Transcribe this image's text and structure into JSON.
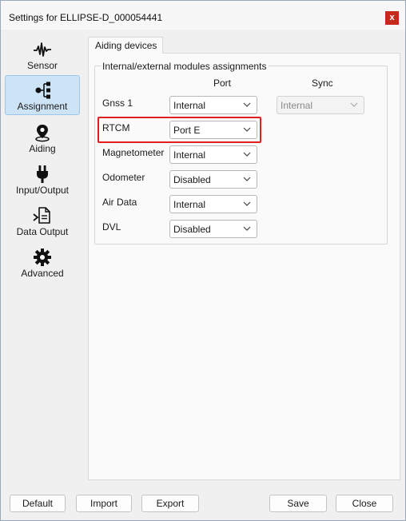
{
  "window": {
    "title": "Settings for ELLIPSE-D_000054441",
    "close_glyph": "x"
  },
  "sidebar": {
    "items": [
      {
        "label": "Sensor",
        "icon": "waveform-icon",
        "active": false
      },
      {
        "label": "Assignment",
        "icon": "hierarchy-icon",
        "active": true
      },
      {
        "label": "Aiding",
        "icon": "location-pin-icon",
        "active": false
      },
      {
        "label": "Input/Output",
        "icon": "plug-icon",
        "active": false
      },
      {
        "label": "Data Output",
        "icon": "document-export-icon",
        "active": false
      },
      {
        "label": "Advanced",
        "icon": "gear-icon",
        "active": false
      }
    ]
  },
  "tab": {
    "label": "Aiding devices"
  },
  "group": {
    "title": "Internal/external modules assignments",
    "col_port": "Port",
    "col_sync": "Sync",
    "rows": [
      {
        "label": "Gnss 1",
        "port": "Internal",
        "sync": "Internal"
      },
      {
        "label": "RTCM",
        "port": "Port E"
      },
      {
        "label": "Magnetometer",
        "port": "Internal"
      },
      {
        "label": "Odometer",
        "port": "Disabled"
      },
      {
        "label": "Air Data",
        "port": "Internal"
      },
      {
        "label": "DVL",
        "port": "Disabled"
      }
    ]
  },
  "buttons": {
    "default": "Default",
    "import": "Import",
    "export": "Export",
    "save": "Save",
    "close": "Close"
  },
  "colors": {
    "highlight": "#e02020",
    "active_nav": "#cde4f7",
    "close": "#c42b1c"
  }
}
